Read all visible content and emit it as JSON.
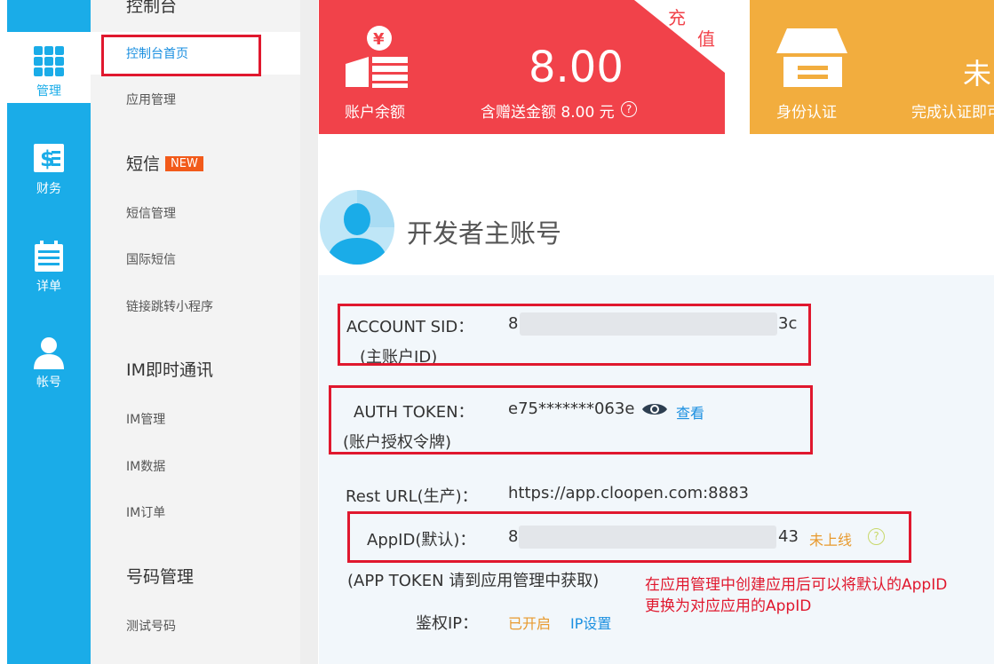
{
  "rail": {
    "items": [
      {
        "label": "管理",
        "icon": "grid-icon"
      },
      {
        "label": "财务",
        "icon": "finance-icon"
      },
      {
        "label": "详单",
        "icon": "calendar-icon"
      },
      {
        "label": "帐号",
        "icon": "user-icon"
      }
    ]
  },
  "submenu": {
    "top_group": "控制台",
    "console_home": "控制台首页",
    "app_manage": "应用管理",
    "sms_group": "短信",
    "new_badge": "NEW",
    "sms_manage": "短信管理",
    "intl_sms": "国际短信",
    "link_mini": "链接跳转小程序",
    "im_group": "IM即时通讯",
    "im_manage": "IM管理",
    "im_data": "IM数据",
    "im_order": "IM订单",
    "number_group": "号码管理",
    "test_number": "测试号码"
  },
  "balance_card": {
    "recharge_1": "充",
    "recharge_2": "值",
    "amount": "8.00",
    "label": "账户余额",
    "gift_text": "含赠送金额 8.00 元",
    "help": "?",
    "color": "#f1424a"
  },
  "id_card": {
    "status": "未",
    "label": "身份认证",
    "desc": "完成认证即可",
    "color": "#f2ad3e"
  },
  "account": {
    "title": "开发者主账号",
    "sid_label": "ACCOUNT SID：",
    "sid_sub": "(主账户ID)",
    "sid_start": "8",
    "sid_end": "3c",
    "token_label": "AUTH TOKEN：",
    "token_sub": "(账户授权令牌)",
    "token_value": "e75*******063e",
    "view_link": "查看",
    "rest_label": "Rest URL(生产)：",
    "rest_value": "https://app.cloopen.com:8883",
    "appid_label": "AppID(默认)：",
    "appid_start": "8a",
    "appid_end": "43",
    "appid_status": "未上线",
    "appid_help": "?",
    "app_token_note": "(APP TOKEN 请到应用管理中获取)",
    "annotation_line1": "在应用管理中创建应用后可以将默认的AppID",
    "annotation_line2": "更换为对应应用的AppID",
    "ip_label": "鉴权IP：",
    "ip_status": "已开启",
    "ip_settings": "IP设置"
  }
}
